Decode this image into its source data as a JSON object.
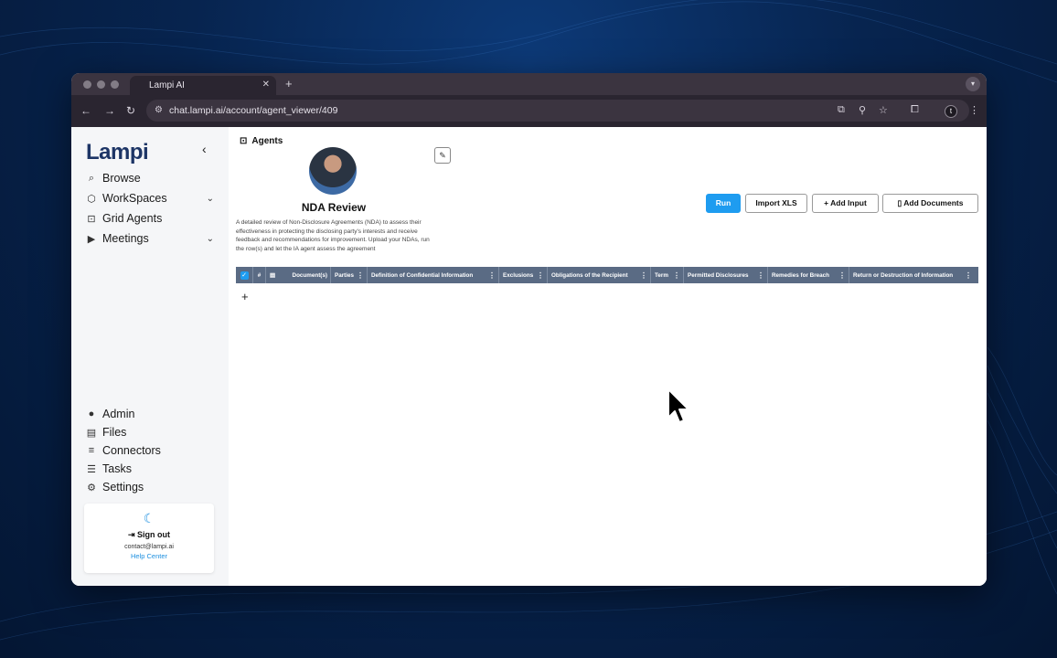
{
  "browser": {
    "tab_title": "Lampi AI",
    "tab_close": "✕",
    "new_tab": "+",
    "url": "chat.lampi.ai/account/agent_viewer/409",
    "profile_initial": "t"
  },
  "sidebar": {
    "logo": "Lampi",
    "nav_top": [
      {
        "label": "Browse",
        "icon": "search-icon"
      },
      {
        "label": "WorkSpaces",
        "icon": "cube-icon",
        "expandable": true
      },
      {
        "label": "Grid Agents",
        "icon": "robot-icon"
      },
      {
        "label": "Meetings",
        "icon": "video-icon",
        "expandable": true
      }
    ],
    "nav_bottom": [
      {
        "label": "Admin",
        "icon": "admin-icon"
      },
      {
        "label": "Files",
        "icon": "file-icon"
      },
      {
        "label": "Connectors",
        "icon": "database-icon"
      },
      {
        "label": "Tasks",
        "icon": "tasks-icon"
      },
      {
        "label": "Settings",
        "icon": "gear-icon"
      }
    ],
    "sign_out": "Sign out",
    "email": "contact@lampi.ai",
    "help": "Help Center"
  },
  "main": {
    "breadcrumb": "Agents",
    "agent_title": "NDA Review",
    "agent_description": "A detailed review of Non-Disclosure Agreements (NDA) to assess their effectiveness in protecting the disclosing party's interests and receive feedback and recommendations for improvement. Upload your NDAs, run the row(s) and let the IA agent assess the agreement",
    "buttons": {
      "run": "Run",
      "import": "Import XLS",
      "add_input": "+ Add Input",
      "add_documents": "Add Documents"
    },
    "grid": {
      "index_header": "#",
      "columns": [
        "Document(s)",
        "Parties",
        "Definition of Confidential Information",
        "Exclusions",
        "Obligations of the Recipient",
        "Term",
        "Permitted Disclosures",
        "Remedies for Breach",
        "Return or Destruction of Information"
      ],
      "add_row": "+"
    }
  },
  "colors": {
    "accent": "#1e9cf0",
    "grid_header": "#5a6b84",
    "brand": "#1d3566"
  }
}
